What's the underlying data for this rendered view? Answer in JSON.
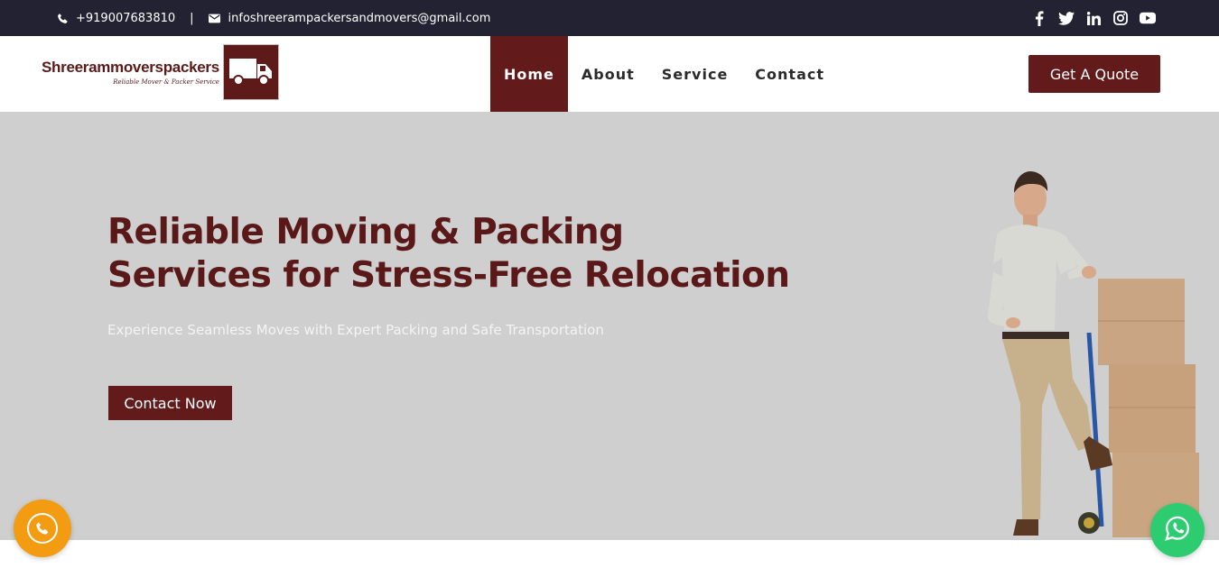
{
  "topbar": {
    "phone": "+919007683810",
    "separator": "|",
    "email": "infoshreerampackersandmovers@gmail.com",
    "social_icons": [
      "facebook-icon",
      "twitter-icon",
      "linkedin-icon",
      "instagram-icon",
      "youtube-icon"
    ]
  },
  "header": {
    "logo_name": "Shreerammoverspackers",
    "logo_tagline": "Reliable Mover & Packer Service",
    "nav": [
      {
        "label": "Home",
        "active": true
      },
      {
        "label": "About",
        "active": false
      },
      {
        "label": "Service",
        "active": false
      },
      {
        "label": "Contact",
        "active": false
      }
    ],
    "quote_button": "Get A Quote"
  },
  "hero": {
    "title_line1": "Reliable Moving & Packing",
    "title_line2": "Services for Stress-Free Relocation",
    "subtitle": "Experience Seamless Moves with Expert Packing and Safe Transportation",
    "cta": "Contact Now"
  },
  "floating": {
    "call_icon": "phone-icon",
    "whatsapp_icon": "whatsapp-icon"
  },
  "colors": {
    "brand": "#621a1a",
    "topbar": "#222232",
    "hero_bg": "#cfcfcf",
    "call": "#f39c12",
    "whatsapp": "#2ecc71"
  }
}
